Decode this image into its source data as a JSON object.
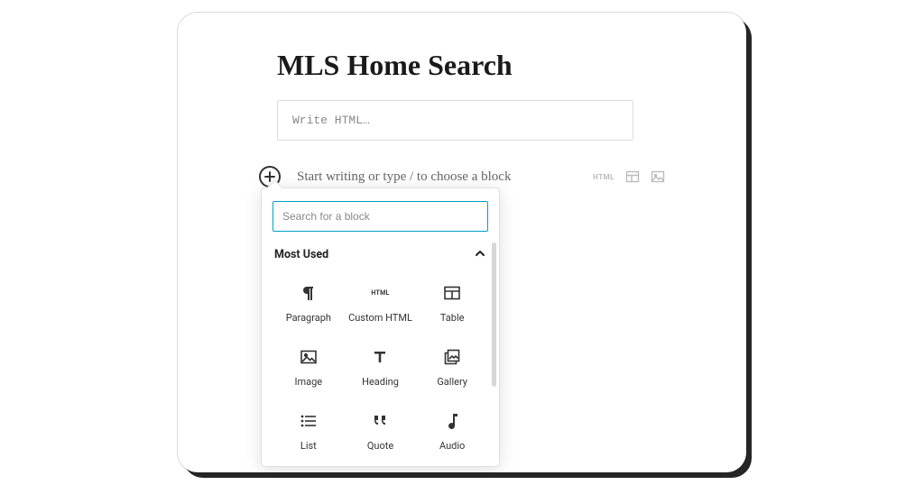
{
  "page": {
    "title": "MLS Home Search",
    "html_placeholder": "Write HTML…",
    "prompt_text": "Start writing or type / to choose a block"
  },
  "toolbar": {
    "html_label": "HTML"
  },
  "inserter": {
    "search_placeholder": "Search for a block",
    "section_title": "Most Used",
    "blocks": {
      "paragraph": "Paragraph",
      "custom_html": "Custom HTML",
      "table": "Table",
      "image": "Image",
      "heading": "Heading",
      "gallery": "Gallery",
      "list": "List",
      "quote": "Quote",
      "audio": "Audio"
    }
  }
}
